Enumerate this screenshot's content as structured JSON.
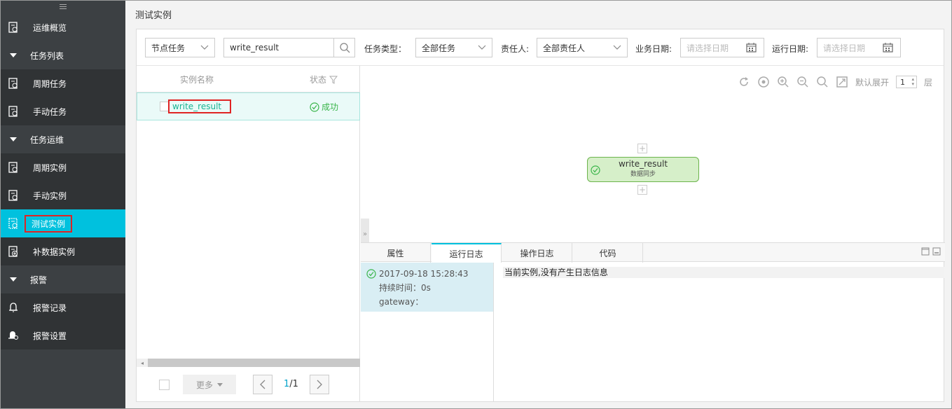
{
  "sidebar": {
    "items": [
      {
        "label": "运维概览",
        "icon": "overview-icon",
        "kind": "top"
      },
      {
        "label": "任务列表",
        "icon": "caret-down-icon",
        "kind": "group"
      },
      {
        "label": "周期任务",
        "icon": "cycle-task-icon",
        "kind": "child"
      },
      {
        "label": "手动任务",
        "icon": "manual-task-icon",
        "kind": "child"
      },
      {
        "label": "任务运维",
        "icon": "caret-down-icon",
        "kind": "group"
      },
      {
        "label": "周期实例",
        "icon": "cycle-instance-icon",
        "kind": "child"
      },
      {
        "label": "手动实例",
        "icon": "manual-instance-icon",
        "kind": "child"
      },
      {
        "label": "测试实例",
        "icon": "test-instance-icon",
        "kind": "active"
      },
      {
        "label": "补数据实例",
        "icon": "backfill-instance-icon",
        "kind": "child"
      },
      {
        "label": "报警",
        "icon": "caret-down-icon",
        "kind": "group"
      },
      {
        "label": "报警记录",
        "icon": "bell-icon",
        "kind": "child"
      },
      {
        "label": "报警设置",
        "icon": "bell-gear-icon",
        "kind": "child"
      }
    ]
  },
  "page": {
    "title": "测试实例"
  },
  "filters": {
    "node_type": "节点任务",
    "search_value": "write_result",
    "task_type_label": "任务类型：",
    "task_type_value": "全部任务",
    "owner_label": "责任人:",
    "owner_value": "全部责任人",
    "biz_date_label": "业务日期:",
    "biz_date_placeholder": "请选择日期",
    "run_date_label": "运行日期:",
    "run_date_placeholder": "请选择日期"
  },
  "list": {
    "col_name": "实例名称",
    "col_status": "状态",
    "rows": [
      {
        "name": "write_result",
        "status": "成功"
      }
    ],
    "more_label": "更多",
    "page_current": "1",
    "page_total": "/1"
  },
  "graph": {
    "default_expand_label": "默认展开",
    "expand_value": "1",
    "layer_label": "层",
    "node": {
      "title": "write_result",
      "subtitle": "数据同步"
    }
  },
  "tabs": [
    {
      "label": "属性"
    },
    {
      "label": "运行日志"
    },
    {
      "label": "操作日志"
    },
    {
      "label": "代码"
    }
  ],
  "log": {
    "time": "2017-09-18 15:28:43",
    "duration": "持续时间：0s",
    "gateway": "gateway：",
    "message": "当前实例,没有产生日志信息"
  },
  "colors": {
    "accent": "#00c1de",
    "success": "#39b54a",
    "sidebar_bg": "#3c4043",
    "highlight": "#e02424"
  }
}
